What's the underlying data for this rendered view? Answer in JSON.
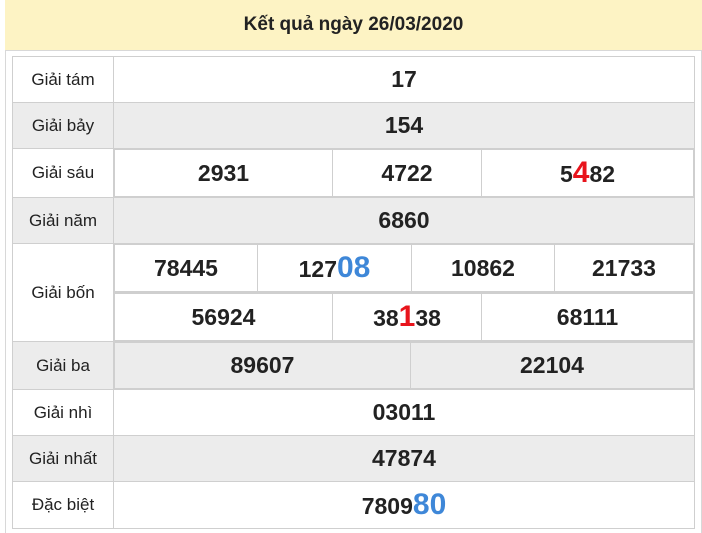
{
  "title": "Kết quả ngày 26/03/2020",
  "prizes": [
    {
      "label": "Giải tám",
      "values": [
        "17"
      ]
    },
    {
      "label": "Giải bảy",
      "values": [
        "154"
      ]
    },
    {
      "label": "Giải sáu",
      "values": [
        "2931",
        "4722",
        {
          "pre": "5",
          "hl": "4",
          "post": "82",
          "hl_color": "red"
        }
      ]
    },
    {
      "label": "Giải năm",
      "values": [
        "6860"
      ]
    },
    {
      "label": "Giải bốn",
      "rows": [
        [
          "78445",
          {
            "pre": "127",
            "hl": "08",
            "post": "",
            "hl_color": "blue"
          },
          "10862",
          "21733"
        ],
        [
          "56924",
          {
            "pre": "38",
            "hl": "1",
            "post": "38",
            "hl_color": "red"
          },
          "68111"
        ]
      ]
    },
    {
      "label": "Giải ba",
      "values": [
        "89607",
        "22104"
      ]
    },
    {
      "label": "Giải nhì",
      "values": [
        "03011"
      ]
    },
    {
      "label": "Giải nhất",
      "values": [
        "47874"
      ]
    },
    {
      "label": "Đặc biệt",
      "values": [
        {
          "pre": "7809",
          "hl": "80",
          "post": "",
          "hl_color": "blue"
        }
      ]
    }
  ],
  "colors": {
    "header_bg": "#fdf3c4",
    "row_shade": "#ececec",
    "highlight_red": "#e8141c",
    "highlight_blue": "#3e87d8"
  }
}
